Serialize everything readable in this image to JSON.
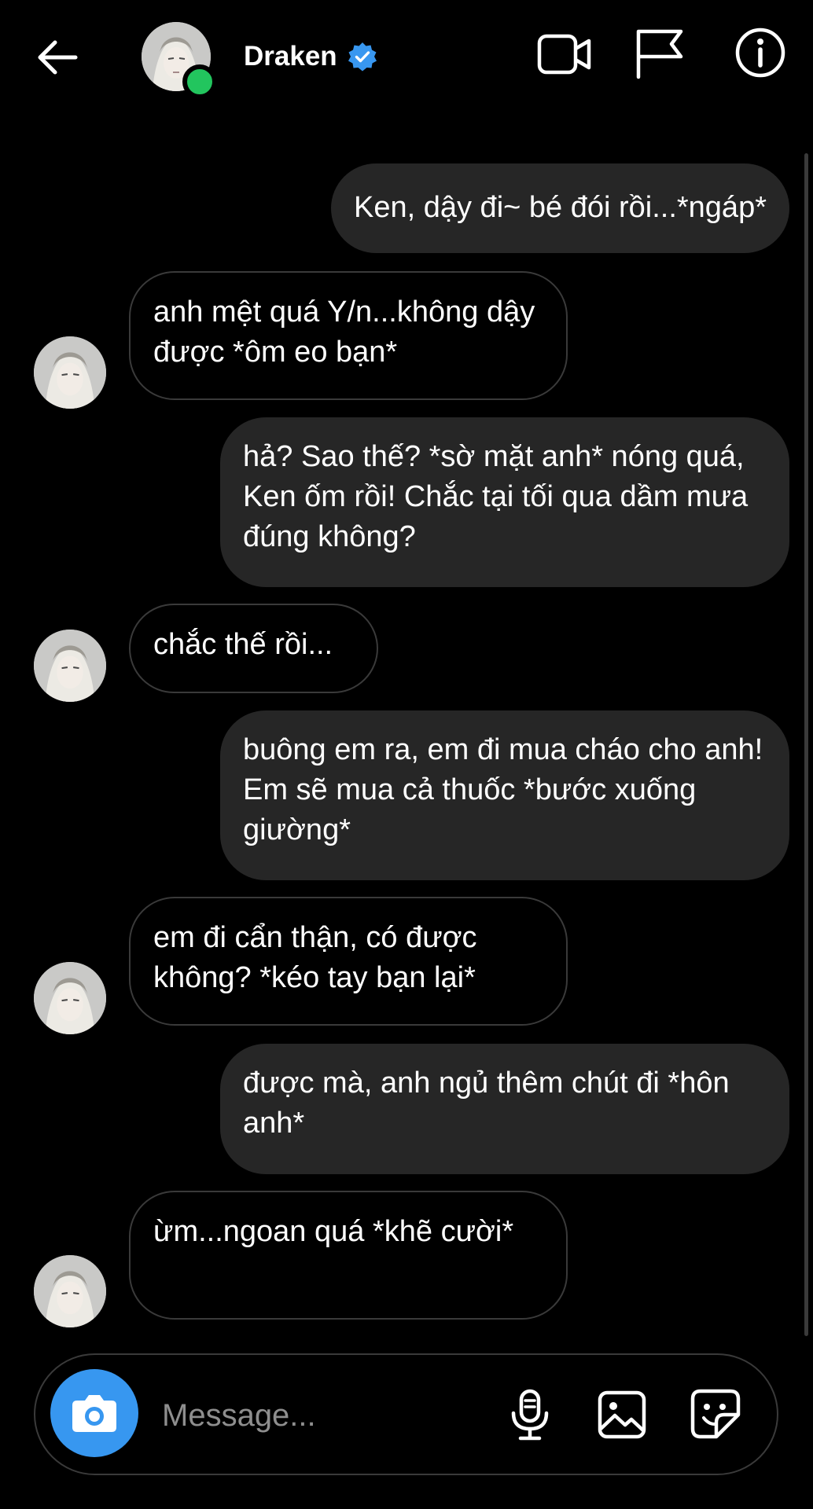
{
  "header": {
    "contact_name": "Draken",
    "icons": {
      "back": "arrow-left-icon",
      "verified": "verified-badge-icon",
      "video": "video-call-icon",
      "flag": "flag-icon",
      "info": "info-icon"
    },
    "online": true,
    "verified_color": "#3897f0"
  },
  "messages": [
    {
      "sender": "me",
      "text": "Ken, dậy đi~ bé đói rồi...*ngáp*"
    },
    {
      "sender": "Draken",
      "text": "anh mệt quá Y/n...không dậy được *ôm eo bạn*"
    },
    {
      "sender": "me",
      "text": "hả? Sao thế? *sờ mặt anh* nóng quá, Ken ốm rồi! Chắc tại tối qua dầm mưa đúng không?"
    },
    {
      "sender": "Draken",
      "text": "chắc thế rồi..."
    },
    {
      "sender": "me",
      "text": "buông em ra, em đi mua cháo cho anh! Em sẽ mua cả thuốc *bước xuống giường*"
    },
    {
      "sender": "Draken",
      "text": "em đi cẩn thận, có được không? *kéo tay bạn lại*"
    },
    {
      "sender": "me",
      "text": "được mà, anh ngủ thêm chút đi *hôn anh*"
    },
    {
      "sender": "Draken",
      "text": "ừm...ngoan quá *khẽ cười*"
    }
  ],
  "composer": {
    "placeholder": "Message...",
    "icons": {
      "camera": "camera-icon",
      "mic": "microphone-icon",
      "gallery": "image-gallery-icon",
      "sticker": "sticker-icon"
    },
    "camera_color": "#3797f0"
  }
}
